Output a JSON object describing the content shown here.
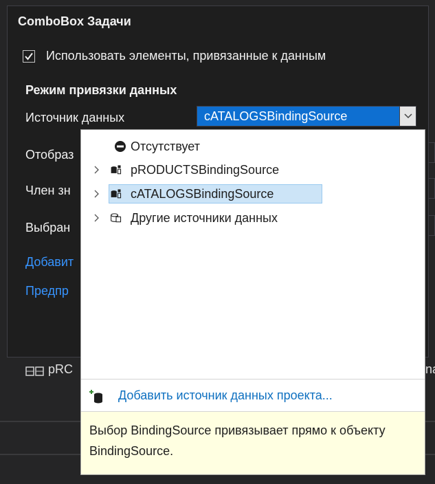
{
  "panel": {
    "title": "ComboBox Задачи",
    "checkbox_label": "Использовать элементы, привязанные к данным",
    "checkbox_checked": true,
    "section_title": "Режим привязки данных",
    "rows": {
      "data_source": "Источник данных",
      "display_member": "Отобраз",
      "value_member": "Член зн",
      "selected_value": "Выбран"
    },
    "links": {
      "add": "Добавит",
      "preview": "Предпр"
    }
  },
  "combo": {
    "value": "cATALOGSBindingSource"
  },
  "background_item": {
    "label": "pRC",
    "right_text": "na"
  },
  "dropdown": {
    "items": {
      "none": "Отсутствует",
      "products": "pRODUCTSBindingSource",
      "catalogs": "cATALOGSBindingSource",
      "other": "Другие источники данных"
    },
    "selected": "cATALOGSBindingSource",
    "add_link": "Добавить источник данных проекта...",
    "help": "Выбор BindingSource привязывает прямо к объекту BindingSource."
  },
  "colors": {
    "accent": "#0e6fd1",
    "link": "#3794ff",
    "help_bg": "#ffffe1",
    "panel_bg": "#1e1e1e"
  }
}
